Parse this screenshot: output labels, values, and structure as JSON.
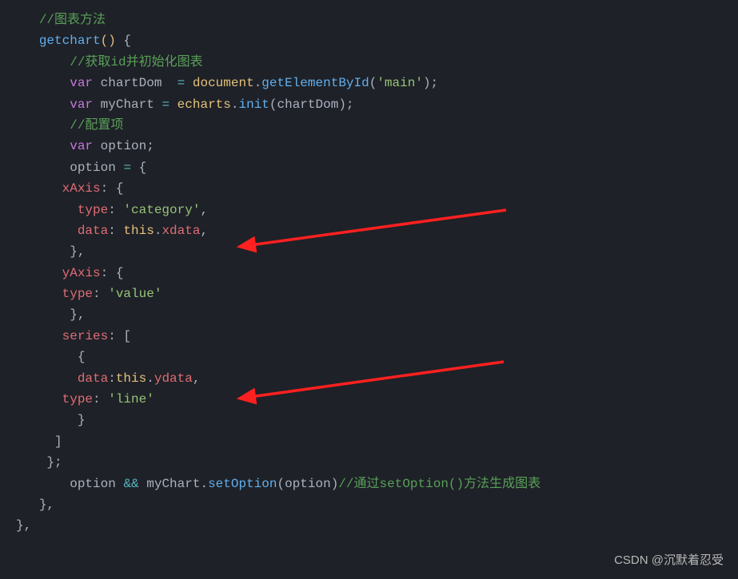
{
  "code": {
    "comment1": "//图表方法",
    "methodName": "getchart",
    "openParen": "()",
    "openBrace": " {",
    "comment2": "//获取id并初始化图表",
    "varKw": "var",
    "chartDomVar": " chartDom  ",
    "equals": "=",
    "documentObj": " document",
    "getElementById": "getElementById",
    "mainStr": "'main'",
    "myChartVar": " myChart ",
    "echartsObj": " echarts",
    "initFunc": "init",
    "chartDomArg": "chartDom",
    "comment3": "//配置项",
    "optionVar": " option",
    "optionAssign": "option ",
    "xAxisKey": "xAxis",
    "typeKey": "type",
    "categoryStr": "'category'",
    "dataKey": "data",
    "thisKw": "this",
    "xdataProp": "xdata",
    "yAxisKey": "yAxis",
    "valueStr": "'value'",
    "seriesKey": "series",
    "ydataProp": "ydata",
    "lineStr": "'line'",
    "andOp": "&&",
    "setOptionFunc": "setOption",
    "optionArg": "option",
    "comment4": "//通过setOption()方法生成图表"
  },
  "watermark": "CSDN @沉默着忍受"
}
